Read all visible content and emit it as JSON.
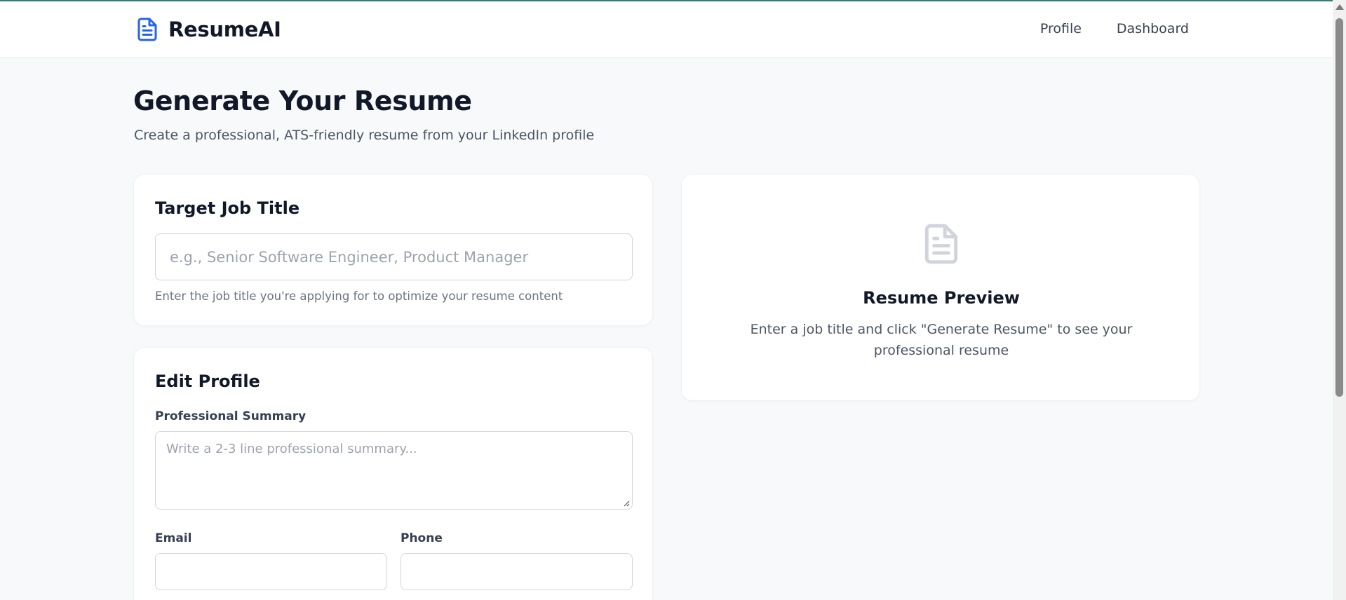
{
  "app": {
    "name": "ResumeAI",
    "logo_icon": "document-icon",
    "accent_color": "#2563eb"
  },
  "nav": {
    "links": [
      {
        "label": "Profile"
      },
      {
        "label": "Dashboard"
      }
    ]
  },
  "header": {
    "title": "Generate Your Resume",
    "subtitle": "Create a professional, ATS-friendly resume from your LinkedIn profile"
  },
  "job_card": {
    "title": "Target Job Title",
    "input_placeholder": "e.g., Senior Software Engineer, Product Manager",
    "input_value": "",
    "helper": "Enter the job title you're applying for to optimize your resume content"
  },
  "edit_card": {
    "title": "Edit Profile",
    "summary_label": "Professional Summary",
    "summary_placeholder": "Write a 2-3 line professional summary...",
    "email_label": "Email",
    "email_value": "",
    "phone_label": "Phone",
    "phone_value": ""
  },
  "preview_card": {
    "icon": "document-icon",
    "title": "Resume Preview",
    "description": "Enter a job title and click \"Generate Resume\" to see your professional resume"
  }
}
